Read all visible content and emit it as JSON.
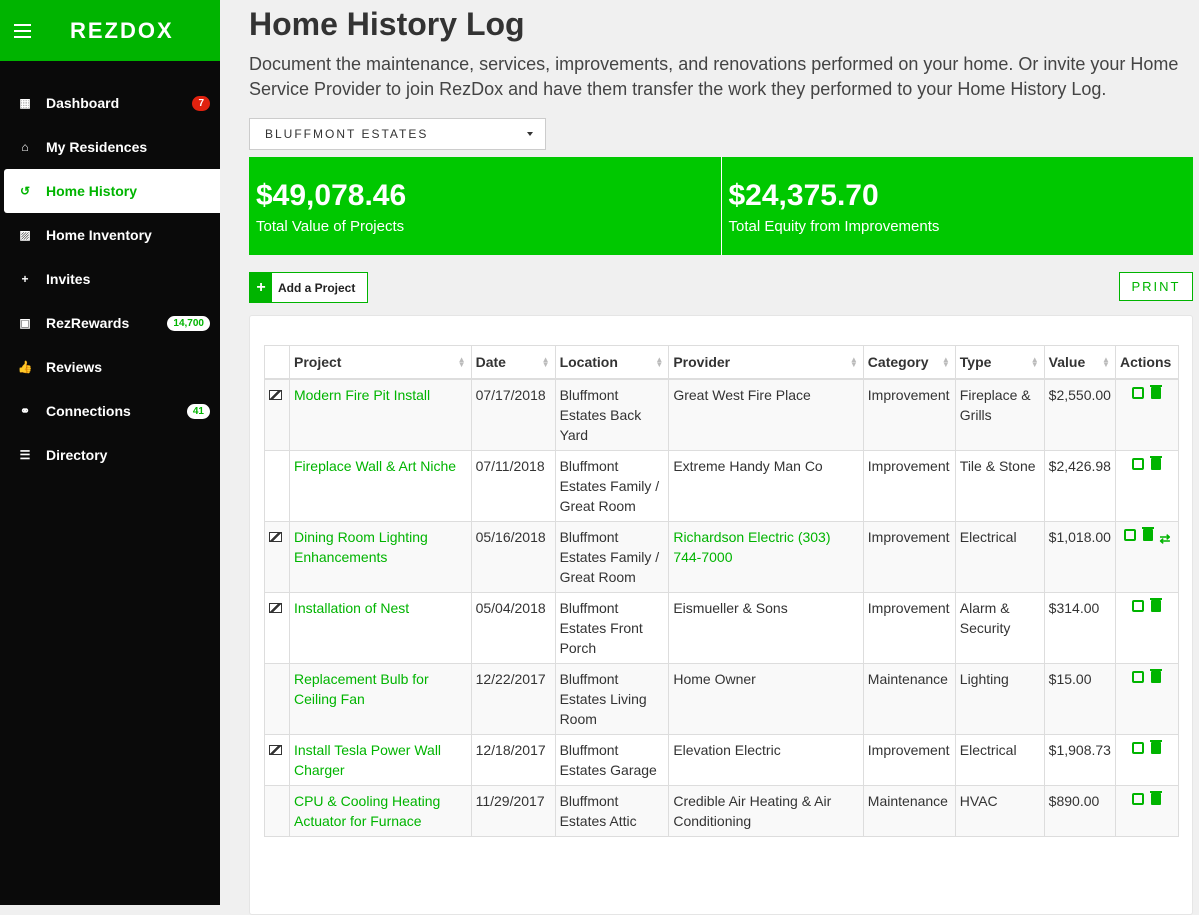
{
  "brand": {
    "logo": "REZDOX"
  },
  "sidebar": {
    "items": [
      {
        "label": "Dashboard",
        "icon": "dashboard-icon",
        "badge": "7",
        "active": false
      },
      {
        "label": "My Residences",
        "icon": "home-icon",
        "badge": "",
        "active": false
      },
      {
        "label": "Home History",
        "icon": "history-icon",
        "badge": "",
        "active": true
      },
      {
        "label": "Home Inventory",
        "icon": "image-icon",
        "badge": "",
        "active": false
      },
      {
        "label": "Invites",
        "icon": "user-plus-icon",
        "badge": "",
        "active": false
      },
      {
        "label": "RezRewards",
        "icon": "money-icon",
        "badge": "14,700",
        "active": false
      },
      {
        "label": "Reviews",
        "icon": "thumbs-up-icon",
        "badge": "",
        "active": false
      },
      {
        "label": "Connections",
        "icon": "handshake-icon",
        "badge": "41",
        "active": false
      },
      {
        "label": "Directory",
        "icon": "list-icon",
        "badge": "",
        "active": false
      }
    ]
  },
  "page": {
    "title": "Home History Log",
    "description": "Document the maintenance, services, improvements, and renovations performed on your home. Or invite your Home Service Provider to join RezDox and have them transfer the work they performed to your Home History Log."
  },
  "residence_select": {
    "value": "BLUFFMONT ESTATES"
  },
  "stats": [
    {
      "value": "$49,078.46",
      "label": "Total Value of Projects"
    },
    {
      "value": "$24,375.70",
      "label": "Total Equity from Improvements"
    }
  ],
  "toolbar": {
    "add_label": "Add a Project",
    "add_symbol": "+",
    "print_label": "PRINT"
  },
  "table": {
    "headers": [
      "Project",
      "Date",
      "Location",
      "Provider",
      "Category",
      "Type",
      "Value",
      "Actions"
    ],
    "rows": [
      {
        "has_image": true,
        "project": "Modern Fire Pit Install",
        "date": "07/17/2018",
        "location": "Bluffmont Estates Back Yard",
        "provider": "Great West Fire Place",
        "provider_link": false,
        "category": "Improvement",
        "type": "Fireplace & Grills",
        "value": "$2,550.00",
        "transfer": false
      },
      {
        "has_image": false,
        "project": "Fireplace Wall & Art Niche",
        "date": "07/11/2018",
        "location": "Bluffmont Estates Family / Great Room",
        "provider": "Extreme Handy Man Co",
        "provider_link": false,
        "category": "Improvement",
        "type": "Tile & Stone",
        "value": "$2,426.98",
        "transfer": false
      },
      {
        "has_image": true,
        "project": "Dining Room Lighting Enhancements",
        "date": "05/16/2018",
        "location": "Bluffmont Estates Family / Great Room",
        "provider": "Richardson Electric (303) 744-7000",
        "provider_link": true,
        "category": "Improvement",
        "type": "Electrical",
        "value": "$1,018.00",
        "transfer": true
      },
      {
        "has_image": true,
        "project": "Installation of Nest",
        "date": "05/04/2018",
        "location": "Bluffmont Estates Front Porch",
        "provider": "Eismueller & Sons",
        "provider_link": false,
        "category": "Improvement",
        "type": "Alarm & Security",
        "value": "$314.00",
        "transfer": false
      },
      {
        "has_image": false,
        "project": "Replacement Bulb for Ceiling Fan",
        "date": "12/22/2017",
        "location": "Bluffmont Estates Living Room",
        "provider": "Home Owner",
        "provider_link": false,
        "category": "Maintenance",
        "type": "Lighting",
        "value": "$15.00",
        "transfer": false
      },
      {
        "has_image": true,
        "project": "Install Tesla Power Wall Charger",
        "date": "12/18/2017",
        "location": "Bluffmont Estates Garage",
        "provider": "Elevation Electric",
        "provider_link": false,
        "category": "Improvement",
        "type": "Electrical",
        "value": "$1,908.73",
        "transfer": false
      },
      {
        "has_image": false,
        "project": "CPU & Cooling Heating Actuator for Furnace",
        "date": "11/29/2017",
        "location": "Bluffmont Estates Attic",
        "provider": "Credible Air Heating & Air Conditioning",
        "provider_link": false,
        "category": "Maintenance",
        "type": "HVAC",
        "value": "$890.00",
        "transfer": false
      }
    ]
  },
  "colors": {
    "brand_green": "#00b400",
    "stat_green": "#00c800",
    "badge_red": "#e0220f",
    "sidebar_bg": "#0a0a0a"
  }
}
